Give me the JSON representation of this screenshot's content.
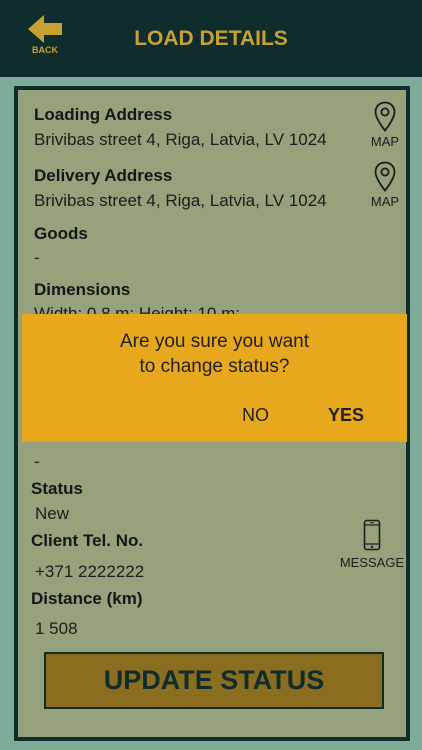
{
  "header": {
    "title": "LOAD DETAILS",
    "back_label": "BACK",
    "back_icon": "arrow-left-icon"
  },
  "colors": {
    "header_bg": "#0f2d2d",
    "accent": "#c9a035",
    "panel_bg": "#96a27b",
    "dialog_bg": "#e8a81e",
    "button_bg": "#8a6d1e"
  },
  "details": {
    "loading_address": {
      "label": "Loading Address",
      "value": "Brivibas street 4, Riga, Latvia, LV 1024",
      "map_label": "MAP",
      "icon": "map-pin-icon"
    },
    "delivery_address": {
      "label": "Delivery Address",
      "value": "Brivibas street 4, Riga, Latvia, LV 1024",
      "map_label": "MAP",
      "icon": "map-pin-icon"
    },
    "goods": {
      "label": "Goods",
      "value": "-"
    },
    "dimensions": {
      "label": "Dimensions",
      "value": "Width: 0.8 m; Height: 10 m;"
    },
    "hidden_value": "-",
    "status": {
      "label": "Status",
      "value": "New"
    },
    "client_tel": {
      "label": "Client Tel. No.",
      "value": "+371 2222222",
      "message_label": "MESSAGE",
      "icon": "phone-icon"
    },
    "distance": {
      "label": "Distance (km)",
      "value": "1 508"
    }
  },
  "update_button": {
    "label": "UPDATE STATUS"
  },
  "dialog": {
    "message_line1": "Are you sure you want",
    "message_line2": "to change status?",
    "no_label": "NO",
    "yes_label": "YES"
  }
}
